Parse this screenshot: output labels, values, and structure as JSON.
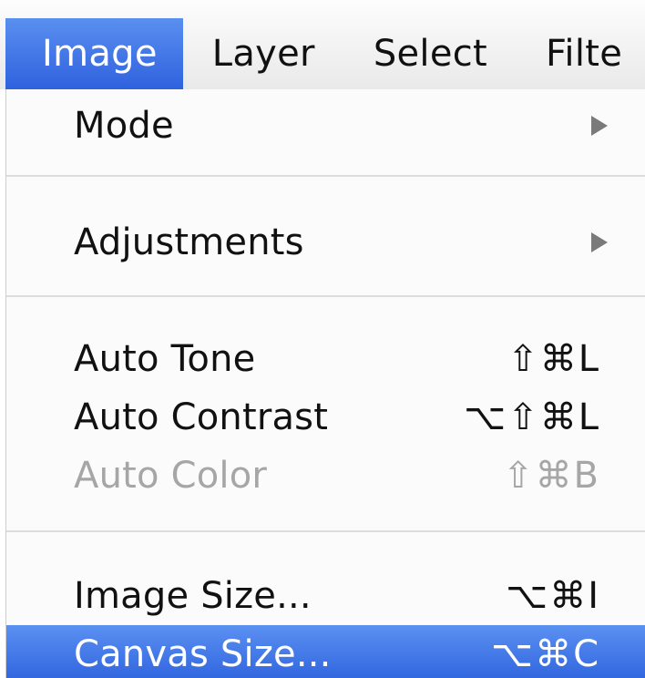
{
  "menubar": {
    "items": [
      {
        "label": "Image",
        "active": true
      },
      {
        "label": "Layer"
      },
      {
        "label": "Select"
      },
      {
        "label": "Filte"
      }
    ]
  },
  "menu": {
    "mode": {
      "label": "Mode",
      "submenu": true
    },
    "adjustments": {
      "label": "Adjustments",
      "submenu": true
    },
    "auto_tone": {
      "label": "Auto Tone",
      "shortcut": "⇧⌘L"
    },
    "auto_contrast": {
      "label": "Auto Contrast",
      "shortcut": "⌥⇧⌘L"
    },
    "auto_color": {
      "label": "Auto Color",
      "shortcut": "⇧⌘B",
      "disabled": true
    },
    "image_size": {
      "label": "Image Size...",
      "shortcut": "⌥⌘I"
    },
    "canvas_size": {
      "label": "Canvas Size...",
      "shortcut": "⌥⌘C",
      "highlighted": true
    }
  },
  "colors": {
    "highlight": "#2f62de",
    "disabled_text": "#a6a6a6",
    "arrow": "#7a7a7a"
  }
}
